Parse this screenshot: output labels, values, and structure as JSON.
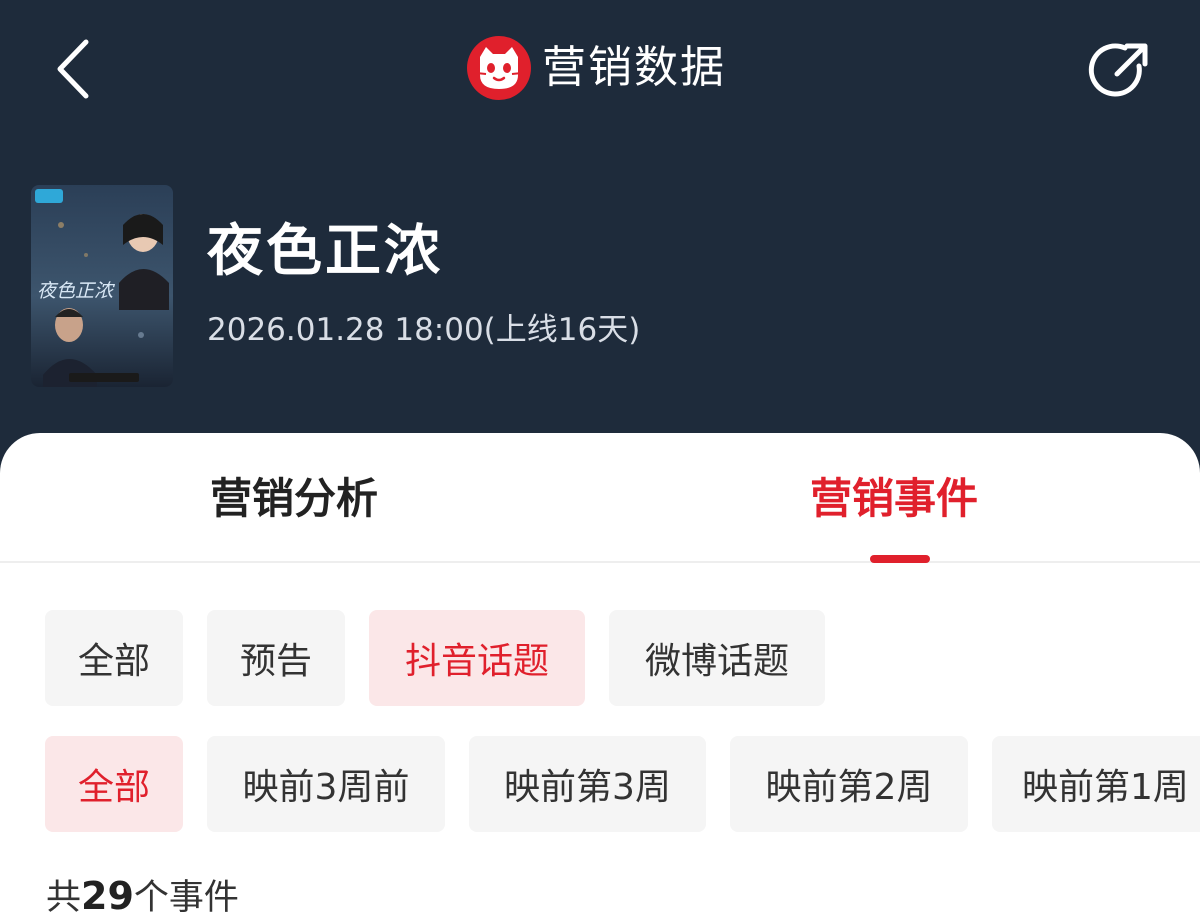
{
  "header": {
    "title": "营销数据",
    "back_icon": "chevron-left-icon",
    "share_icon": "share-icon",
    "logo_icon": "maoyan-cat-logo-icon"
  },
  "movie": {
    "poster_title": "夜色正浓",
    "title": "夜色正浓",
    "release": "2026.01.28 18:00(上线16天)"
  },
  "tabs": [
    {
      "label": "营销分析",
      "active": false
    },
    {
      "label": "营销事件",
      "active": true
    }
  ],
  "source_filters": [
    {
      "label": "全部",
      "active": false
    },
    {
      "label": "预告",
      "active": false
    },
    {
      "label": "抖音话题",
      "active": true
    },
    {
      "label": "微博话题",
      "active": false
    }
  ],
  "time_filters": [
    {
      "label": "全部",
      "active": true
    },
    {
      "label": "映前3周前",
      "active": false
    },
    {
      "label": "映前第3周",
      "active": false
    },
    {
      "label": "映前第2周",
      "active": false
    },
    {
      "label": "映前第1周",
      "active": false
    }
  ],
  "summary": {
    "prefix": "共",
    "count": "29",
    "suffix": "个事件"
  },
  "colors": {
    "accent": "#e0202c",
    "nav_bg": "#1e2b3b",
    "chip_bg": "#f5f5f5",
    "chip_active_bg": "#fbe7e8"
  }
}
